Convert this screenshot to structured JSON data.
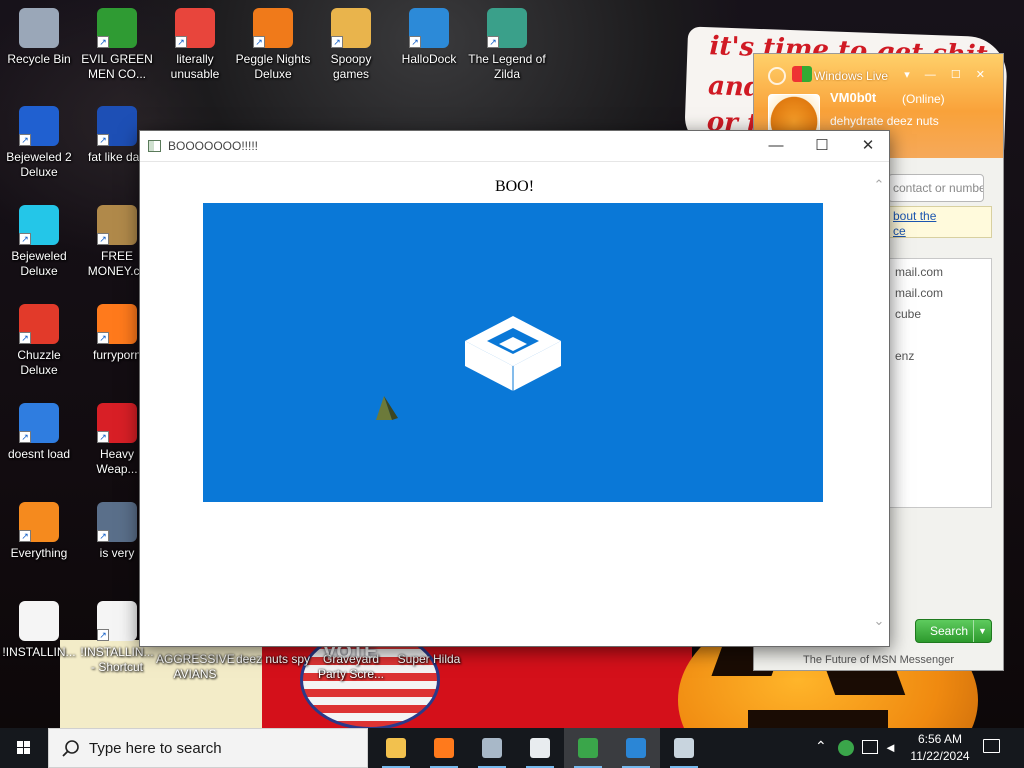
{
  "wallpaper": {
    "sign_lines": [
      "it's time to get shit",
      "and",
      "or t"
    ],
    "red_text": "VOTE"
  },
  "desktop": {
    "icons": [
      {
        "label": "Recycle Bin",
        "icon": "recycle-bin-icon",
        "color": "#9aa7b8"
      },
      {
        "label": "EVIL GREEN MEN CO...",
        "icon": "people-icon",
        "color": "#2f9b33"
      },
      {
        "label": "literally unusable",
        "icon": "chrome-icon",
        "color": "#e8453c"
      },
      {
        "label": "Peggle Nights Deluxe",
        "icon": "peggle-icon",
        "color": "#f07a1a"
      },
      {
        "label": "Spoopy games",
        "icon": "folder-icon",
        "color": "#e9b44c"
      },
      {
        "label": "HalloDock",
        "icon": "windows-shield-icon",
        "color": "#2c8ad8"
      },
      {
        "label": "The Legend of Zilda",
        "icon": "zilda-icon",
        "color": "#3aa08a"
      },
      {
        "label": "Bejeweled 2 Deluxe",
        "icon": "bejeweled2-icon",
        "color": "#2060d0"
      },
      {
        "label": "fat like darl",
        "icon": "mpl-icon",
        "color": "#1d4fb5"
      },
      {
        "label": "Bejeweled Deluxe",
        "icon": "diamond-icon",
        "color": "#24c6e8"
      },
      {
        "label": "FREE MONEY.co",
        "icon": "money-bag-icon",
        "color": "#b0894a"
      },
      {
        "label": "Chuzzle Deluxe",
        "icon": "chuzzle-icon",
        "color": "#e23a2a"
      },
      {
        "label": "furryporn",
        "icon": "firefox-icon",
        "color": "#ff7a1c"
      },
      {
        "label": "doesnt load",
        "icon": "thunderbird-icon",
        "color": "#2f7de0"
      },
      {
        "label": "Heavy Weap...",
        "icon": "radiation-icon",
        "color": "#d81f26"
      },
      {
        "label": "Everything",
        "icon": "everything-search-icon",
        "color": "#f58a1e"
      },
      {
        "label": "is very",
        "icon": "mpl-shield-icon",
        "color": "#5a6f8a"
      },
      {
        "label": "!INSTALLIN...",
        "icon": "text-file-icon",
        "color": "#f5f5f5"
      },
      {
        "label": "!INSTALLIN... - Shortcut",
        "icon": "text-file-icon",
        "color": "#f5f5f5"
      },
      {
        "label": "AGGRESSIVE AVIANS",
        "icon": "",
        "color": ""
      },
      {
        "label": "deez nuts spy",
        "icon": "",
        "color": ""
      },
      {
        "label": "Graveyard Party Scre...",
        "icon": "",
        "color": ""
      },
      {
        "label": "Super Hilda",
        "icon": "",
        "color": ""
      }
    ]
  },
  "msn": {
    "title": "Windows Live",
    "display_name": "VM0b0t",
    "status": "(Online)",
    "personal_message": "dehydrate deez nuts",
    "search_placeholder": "contact or numbe",
    "notice_link_1": "bout the",
    "notice_link_2": "ce",
    "contacts": [
      "mail.com",
      "mail.com",
      "cube",
      "enz"
    ],
    "search_button": "Search",
    "footer": "The Future of MSN Messenger"
  },
  "window": {
    "title": "BOOOOOOO!!!!!",
    "heading": "BOO!",
    "panel_color": "#0a78d7",
    "minimize_label": "—",
    "maximize_label": "☐",
    "close_label": "✕"
  },
  "taskbar": {
    "search_placeholder": "Type here to search",
    "apps": [
      {
        "name": "file-explorer",
        "icon": "folder-icon"
      },
      {
        "name": "firefox",
        "icon": "firefox-icon"
      },
      {
        "name": "app-3",
        "icon": "stacked-windows-icon"
      },
      {
        "name": "app-4",
        "icon": "window-icon"
      },
      {
        "name": "msn-messenger",
        "icon": "msn-people-icon"
      },
      {
        "name": "sandbox",
        "icon": "sandbox-box-icon"
      },
      {
        "name": "app-7",
        "icon": "image-viewer-icon"
      }
    ],
    "time": "6:56 AM",
    "date": "11/22/2024"
  }
}
